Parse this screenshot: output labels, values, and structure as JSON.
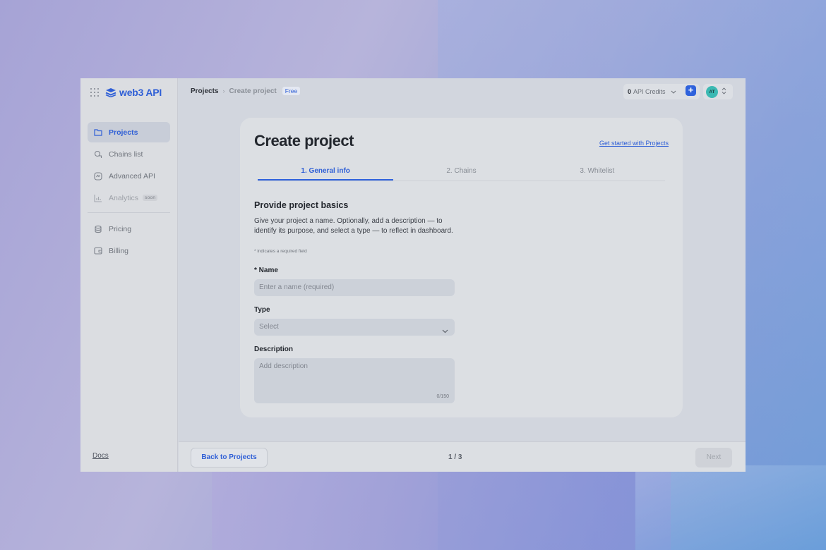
{
  "app": {
    "name": "web3 API"
  },
  "sidebar": {
    "items": [
      {
        "label": "Projects"
      },
      {
        "label": "Chains list"
      },
      {
        "label": "Advanced API"
      },
      {
        "label": "Analytics",
        "badge": "soon"
      },
      {
        "label": "Pricing"
      },
      {
        "label": "Billing"
      }
    ],
    "docs_label": "Docs"
  },
  "header": {
    "breadcrumb": [
      "Projects",
      "Create project"
    ],
    "plan_badge": "Free",
    "credits_value": "0",
    "credits_label": "API Credits",
    "add_button": "+",
    "avatar_initials": "AT"
  },
  "form": {
    "title": "Create project",
    "get_started_link": "Get started with Projects",
    "steps": [
      "1. General info",
      "2. Chains",
      "3. Whitelist"
    ],
    "section_title": "Provide project basics",
    "section_desc": "Give your project a name. Optionally, add a description — to identify its purpose, and select a type — to reflect in dashboard.",
    "required_note": "* indicates a required field",
    "name_label": "* Name",
    "name_placeholder": "Enter a name (required)",
    "type_label": "Type",
    "type_value": "Select",
    "description_label": "Description",
    "description_placeholder": "Add description",
    "description_counter": "0/150"
  },
  "footer": {
    "back_label": "Back to Projects",
    "pager": "1 / 3",
    "next_label": "Next"
  },
  "colors": {
    "accent": "#2f5fd6",
    "avatar": "#3bb9b3"
  }
}
